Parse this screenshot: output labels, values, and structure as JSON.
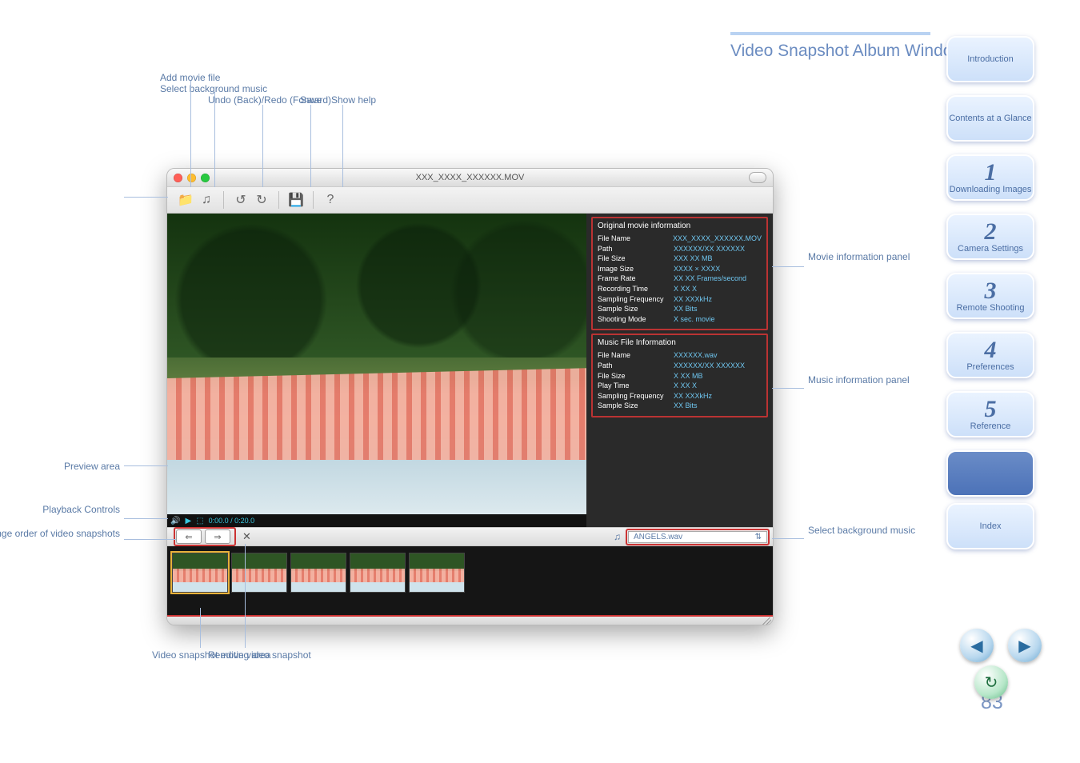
{
  "page": {
    "title": "Video Snapshot Album Window",
    "number": "83"
  },
  "nav": {
    "tabs": [
      {
        "big": "",
        "small": "Introduction"
      },
      {
        "big": "",
        "small": "Contents at a Glance"
      },
      {
        "big": "1",
        "small": "Downloading Images"
      },
      {
        "big": "2",
        "small": "Camera Settings"
      },
      {
        "big": "3",
        "small": "Remote Shooting"
      },
      {
        "big": "4",
        "small": "Preferences"
      },
      {
        "big": "5",
        "small": "Reference"
      },
      {
        "big": "",
        "small": "Index"
      }
    ],
    "back": "◀",
    "fwd": "▶",
    "ret": "↻"
  },
  "window": {
    "title": "XXX_XXXX_XXXXXX.MOV",
    "toolbar": {
      "open": "📁",
      "music": "♫",
      "undo": "↺",
      "redo": "↻",
      "save": "💾",
      "help": "?"
    },
    "preview": {
      "ctl_vol": "🔊",
      "ctl_play": "▶",
      "ctl_toggle": "⬚",
      "time": "0:00.0 / 0:20.0"
    },
    "movie_info": {
      "heading": "Original movie information",
      "rows": [
        {
          "l": "File Name",
          "v": "XXX_XXXX_XXXXXX.MOV"
        },
        {
          "l": "Path",
          "v": "XXXXXX/XX  XXXXXX"
        },
        {
          "l": "File Size",
          "v": "XXX XX MB"
        },
        {
          "l": "Image Size",
          "v": "XXXX × XXXX"
        },
        {
          "l": "Frame Rate",
          "v": "XX  XX Frames/second"
        },
        {
          "l": "Recording Time",
          "v": "X XX X"
        },
        {
          "l": "Sampling Frequency",
          "v": "XX  XXXkHz"
        },
        {
          "l": "Sample Size",
          "v": "XX Bits"
        },
        {
          "l": "Shooting Mode",
          "v": "X sec. movie"
        }
      ]
    },
    "music_info": {
      "heading": "Music File Information",
      "rows": [
        {
          "l": "File Name",
          "v": "XXXXXX.wav"
        },
        {
          "l": "Path",
          "v": "XXXXXX/XX  XXXXXX"
        },
        {
          "l": "File Size",
          "v": "X XX MB"
        },
        {
          "l": "Play Time",
          "v": "X XX X"
        },
        {
          "l": "Sampling Frequency",
          "v": "XX  XXXkHz"
        },
        {
          "l": "Sample Size",
          "v": "XX Bits"
        }
      ]
    },
    "sequence": {
      "prev": "⇐",
      "next": "⇒",
      "remove": "✕",
      "music_icon": "♫",
      "bgm_name": "ANGELS.wav"
    }
  },
  "callouts": {
    "help": "Show help",
    "save": "Save",
    "undo_redo": "Undo (Back)/Redo (Forward)",
    "select_music": "Select background music",
    "add_movie": "Add movie file",
    "movie_panel": "Movie information panel",
    "music_panel": "Music information panel",
    "preview_area": "Preview area",
    "controls": "Playback Controls",
    "select_bgm": "Select background music",
    "change_order": "Change order of video snapshots",
    "remove_snap": "Remove video snapshot",
    "editing_area": "Video snapshot editing area"
  }
}
